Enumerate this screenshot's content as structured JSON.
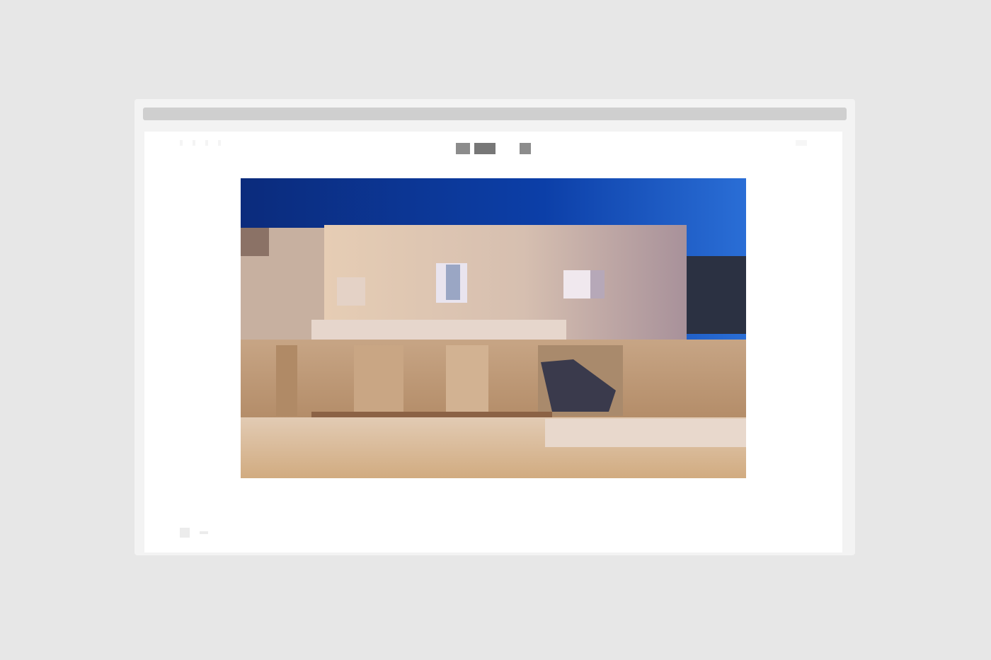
{
  "nav": {
    "items": [
      "",
      "",
      "",
      ""
    ]
  },
  "logo": {
    "mark": "",
    "sub": ""
  },
  "header": {
    "right_label": ""
  },
  "hero": {
    "image_description": ""
  },
  "caption": {
    "left": "",
    "right": ""
  },
  "footer": {
    "name": "",
    "tagline": "",
    "links": [
      "",
      "",
      ""
    ]
  },
  "colors": {
    "page_background": "#e7e7e7",
    "sky_dark": "#0a2a7a",
    "sky_light": "#1f62d8",
    "facade": "#d8c0a8",
    "wall": "#b89a76"
  }
}
